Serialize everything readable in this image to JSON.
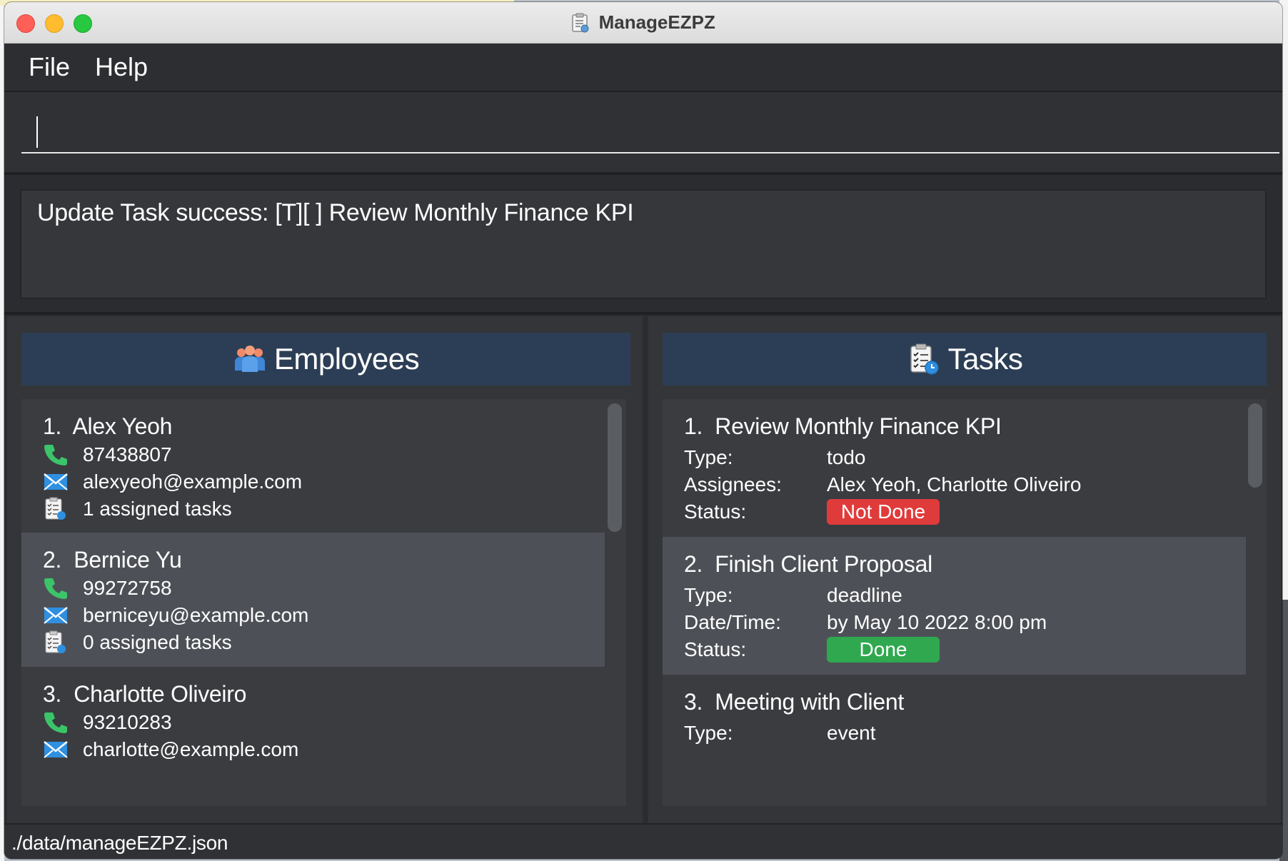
{
  "window": {
    "title": "ManageEZPZ"
  },
  "menu": {
    "file": "File",
    "help": "Help"
  },
  "command": {
    "value": "",
    "placeholder": ""
  },
  "result": {
    "text": "Update Task success: [T][ ] Review Monthly Finance KPI"
  },
  "employees": {
    "header": "Employees",
    "items": [
      {
        "index": "1.",
        "name": "Alex Yeoh",
        "phone": "87438807",
        "email": "alexyeoh@example.com",
        "tasks": "1 assigned tasks"
      },
      {
        "index": "2.",
        "name": "Bernice Yu",
        "phone": "99272758",
        "email": "berniceyu@example.com",
        "tasks": "0 assigned tasks"
      },
      {
        "index": "3.",
        "name": "Charlotte Oliveiro",
        "phone": "93210283",
        "email": "charlotte@example.com"
      }
    ]
  },
  "tasks": {
    "header": "Tasks",
    "items": [
      {
        "index": "1.",
        "name": "Review Monthly Finance KPI",
        "fields": [
          {
            "label": "Type:",
            "value": "todo"
          },
          {
            "label": "Assignees:",
            "value": "Alex Yeoh, Charlotte Oliveiro"
          }
        ],
        "status_label": "Status:",
        "status": "Not Done"
      },
      {
        "index": "2.",
        "name": "Finish Client Proposal",
        "fields": [
          {
            "label": "Type:",
            "value": "deadline"
          },
          {
            "label": "Date/Time:",
            "value": "by May 10 2022 8:00 pm"
          }
        ],
        "status_label": "Status:",
        "status": "Done"
      },
      {
        "index": "3.",
        "name": "Meeting with Client",
        "fields": [
          {
            "label": "Type:",
            "value": "event"
          }
        ]
      }
    ]
  },
  "status_bar": {
    "path": "./data/manageEZPZ.json"
  },
  "colors": {
    "header_bg": "#2c3e55",
    "not_done": "#e03b3b",
    "done": "#2fa84f",
    "phone_icon": "#3cc46a",
    "email_icon": "#2f8fe0"
  },
  "icons": {
    "phone": "phone-icon",
    "email": "email-icon",
    "tasks": "assigned-tasks-icon",
    "employees": "employees-icon",
    "task_list": "tasks-clipboard-icon"
  }
}
